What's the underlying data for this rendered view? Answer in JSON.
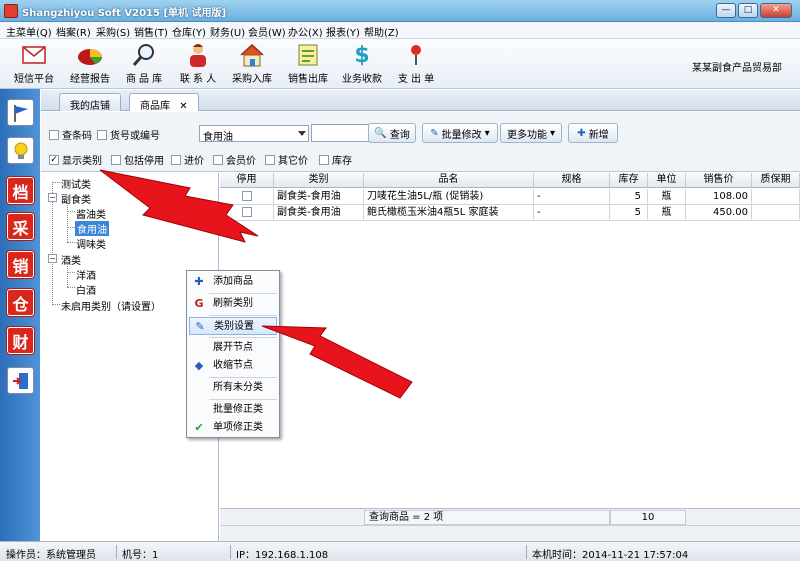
{
  "window": {
    "title": "Shangzhiyou Soft V2015 [单机 试用版]",
    "min": "—",
    "max": "□",
    "close": "✕"
  },
  "menu": [
    "主菜单(Q)",
    "档案(R)",
    "采购(S)",
    "销售(T)",
    "仓库(Y)",
    "财务(U)",
    "会员(W)",
    "办公(X)",
    "报表(Y)",
    "帮助(Z)"
  ],
  "toolbar": [
    {
      "label": "短信平台",
      "icon": "envelope-icon"
    },
    {
      "label": "经营报告",
      "icon": "pie-chart-icon"
    },
    {
      "label": "商 品 库",
      "icon": "magnifier-icon"
    },
    {
      "label": "联 系 人",
      "icon": "person-icon"
    },
    {
      "label": "采购入库",
      "icon": "house-icon"
    },
    {
      "label": "销售出库",
      "icon": "ledger-icon"
    },
    {
      "label": "业务收款",
      "icon": "dollar-icon"
    },
    {
      "label": "支 出 单",
      "icon": "pin-icon"
    }
  ],
  "company": "某某副食产品贸易部",
  "leftbar": [
    "flag-icon",
    "bulb-icon",
    "档",
    "采",
    "销",
    "仓",
    "财",
    "exit-icon"
  ],
  "tabs": [
    {
      "label": "我的店铺"
    },
    {
      "label": "商品库",
      "close": "✕"
    }
  ],
  "search": {
    "barcode": "查条码",
    "code": "货号或编号",
    "combo_value": "食用油",
    "query_btn": "查询",
    "batch_btn": "批量修改",
    "more_btn": "更多功能",
    "add_btn": "新增",
    "show_category": "显示类别",
    "show_category_check": "✓",
    "include_disabled": "包括停用",
    "purchase_price": "进价",
    "member_price": "会员价",
    "other_price": "其它价",
    "stock": "库存"
  },
  "tree": [
    {
      "label": "测试类"
    },
    {
      "label": "副食类",
      "toggle": "−"
    },
    {
      "label": "酱油类"
    },
    {
      "label": "食用油"
    },
    {
      "label": "调味类"
    },
    {
      "label": "酒类",
      "toggle": "−"
    },
    {
      "label": "洋酒"
    },
    {
      "label": "白酒"
    },
    {
      "label": "未启用类别（请设置）"
    }
  ],
  "grid": {
    "columns": [
      "停用",
      "类别",
      "品名",
      "规格",
      "库存",
      "单位",
      "销售价",
      "质保期"
    ],
    "rows": [
      {
        "category": "副食类-食用油",
        "name": "刀唛花生油5L/瓶 (促销装)",
        "spec": "-",
        "stock": "5",
        "unit": "瓶",
        "price": "108.00"
      },
      {
        "category": "副食类-食用油",
        "name": "鲍氏橄榄玉米油4瓶5L 家庭装",
        "spec": "-",
        "stock": "5",
        "unit": "瓶",
        "price": "450.00"
      }
    ],
    "footer_query": "查询商品 = 2 项",
    "footer_stock": "10"
  },
  "context_menu": [
    {
      "label": "添加商品",
      "icon": "plus-icon",
      "glyph": "✚"
    },
    {
      "label": "刷新类别",
      "icon": "refresh-icon",
      "glyph": "G"
    },
    {
      "label": "类别设置",
      "icon": "pencil-icon",
      "glyph": "✎"
    },
    {
      "label": "展开节点",
      "icon": "",
      "glyph": ""
    },
    {
      "label": "收缩节点",
      "icon": "diamond-icon",
      "glyph": "◆"
    },
    {
      "label": "所有未分类",
      "icon": "",
      "glyph": ""
    },
    {
      "label": "批量修正类",
      "icon": "",
      "glyph": ""
    },
    {
      "label": "单项修正类",
      "icon": "check-icon",
      "glyph": "✔"
    }
  ],
  "status": {
    "operator": "操作员：系统管理员",
    "machine": "机号：1",
    "ip": "IP：192.168.1.108",
    "time": "本机时间：2014-11-21 17:57:04"
  },
  "colors": {
    "accent": "#3a86d8",
    "arrow": "#e8141c",
    "leftbar": "#2c6fb8"
  }
}
